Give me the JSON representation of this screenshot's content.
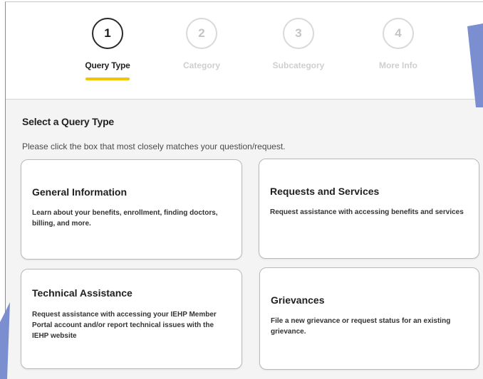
{
  "stepper": {
    "steps": [
      {
        "number": "1",
        "label": "Query Type",
        "state": "active"
      },
      {
        "number": "2",
        "label": "Category",
        "state": "inactive"
      },
      {
        "number": "3",
        "label": "Subcategory",
        "state": "inactive"
      },
      {
        "number": "4",
        "label": "More Info",
        "state": "inactive"
      }
    ],
    "active_color": "#f2c500"
  },
  "main": {
    "title": "Select a Query Type",
    "description": "Please click the box that most closely matches your question/request.",
    "cards": [
      {
        "title": "General Information",
        "description": "Learn about your benefits, enrollment, finding doctors, billing, and more."
      },
      {
        "title": "Requests and Services",
        "description": "Request assistance with accessing benefits and services"
      },
      {
        "title": "Technical Assistance",
        "description": "Request assistance with accessing your IEHP Member Portal account and/or report technical issues with the IEHP website"
      },
      {
        "title": "Grievances",
        "description": "File a new grievance or request status for an existing grievance."
      }
    ]
  },
  "colors": {
    "decor_blue": "#7b8fd0"
  }
}
